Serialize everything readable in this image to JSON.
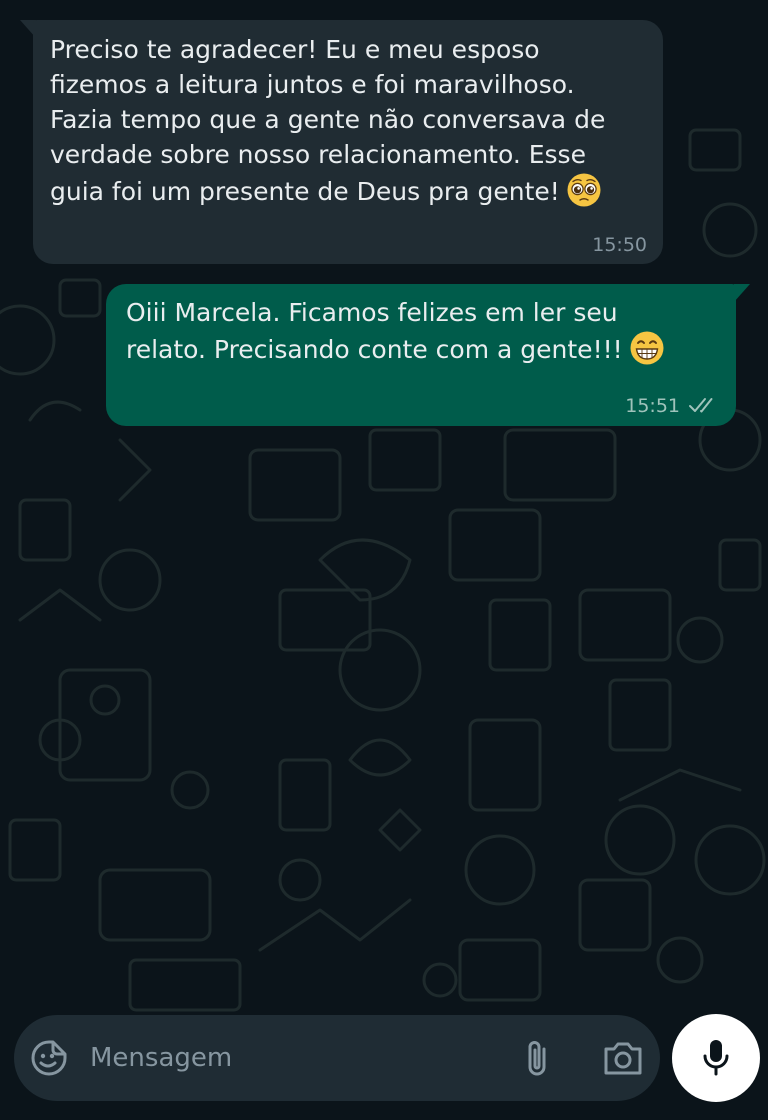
{
  "chat": {
    "messages": [
      {
        "direction": "incoming",
        "text": "Preciso te agradecer! Eu e meu esposo\nfizemos a leitura juntos e foi maravilhoso.\nFazia tempo que a gente não conversava de\nverdade sobre nosso relacionamento. Esse\nguia foi um presente de Deus pra gente!",
        "emoji": "pleading-face",
        "time": "15:50"
      },
      {
        "direction": "outgoing",
        "text": "Oiii Marcela. Ficamos felizes em ler seu\nrelato. Precisando conte com a gente!!!",
        "emoji": "grinning-face",
        "time": "15:51",
        "status": "delivered"
      }
    ]
  },
  "composer": {
    "placeholder": "Mensagem"
  },
  "colors": {
    "background": "#0b141a",
    "incoming_bubble": "#202c33",
    "outgoing_bubble": "#005c4b",
    "input_bar": "#1f2c34",
    "mic_button": "#ffffff",
    "secondary_text": "#8696a0"
  }
}
